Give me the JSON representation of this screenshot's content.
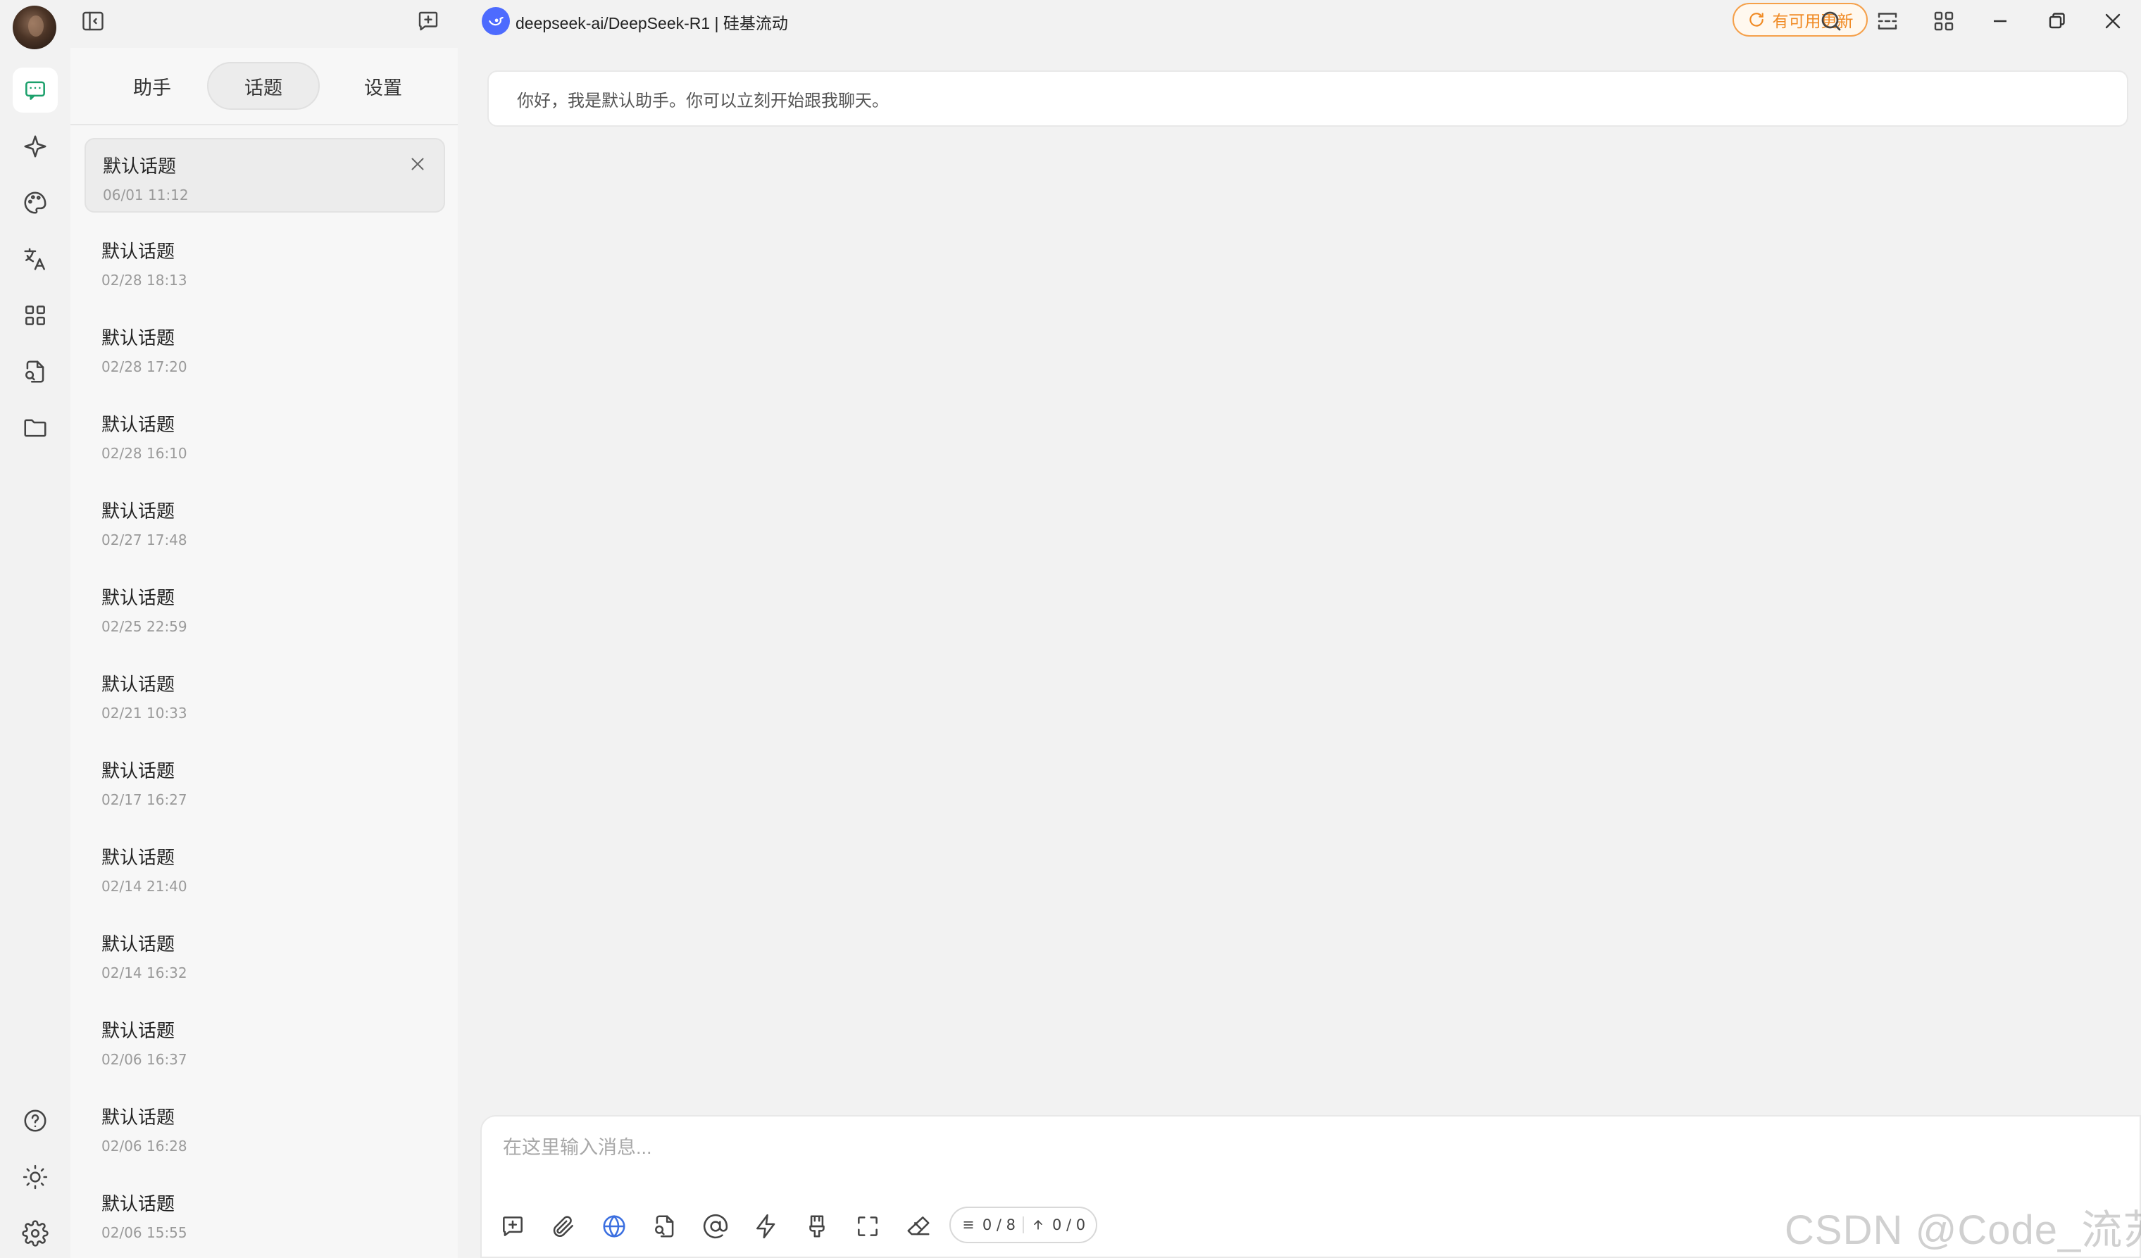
{
  "app": {
    "model_title": "deepseek-ai/DeepSeek-R1 | 硅基流动",
    "update_label": "有可用更新",
    "accent_color": "#1ba06b",
    "update_color": "#f08a24",
    "model_logo_color": "#4d6bfe"
  },
  "rail": {
    "items": [
      {
        "name": "chat-icon",
        "active": true
      },
      {
        "name": "sparkle-icon",
        "active": false
      },
      {
        "name": "palette-icon",
        "active": false
      },
      {
        "name": "translate-icon",
        "active": false
      },
      {
        "name": "apps-grid-icon",
        "active": false
      },
      {
        "name": "file-search-icon",
        "active": false
      },
      {
        "name": "folder-icon",
        "active": false
      }
    ],
    "bottom_items": [
      "help-icon",
      "sun-icon",
      "gear-icon"
    ]
  },
  "tabs": {
    "assistant": "助手",
    "topics": "话题",
    "settings": "设置",
    "active": "topics"
  },
  "topics": [
    {
      "title": "默认话题",
      "time": "06/01 11:12",
      "active": true
    },
    {
      "title": "默认话题",
      "time": "02/28 18:13"
    },
    {
      "title": "默认话题",
      "time": "02/28 17:20"
    },
    {
      "title": "默认话题",
      "time": "02/28 16:10"
    },
    {
      "title": "默认话题",
      "time": "02/27 17:48"
    },
    {
      "title": "默认话题",
      "time": "02/25 22:59"
    },
    {
      "title": "默认话题",
      "time": "02/21 10:33"
    },
    {
      "title": "默认话题",
      "time": "02/17 16:27"
    },
    {
      "title": "默认话题",
      "time": "02/14 21:40"
    },
    {
      "title": "默认话题",
      "time": "02/14 16:32"
    },
    {
      "title": "默认话题",
      "time": "02/06 16:37"
    },
    {
      "title": "默认话题",
      "time": "02/06 16:28"
    },
    {
      "title": "默认话题",
      "time": "02/06 15:55"
    }
  ],
  "chat": {
    "greeting": "你好，我是默认助手。你可以立刻开始跟我聊天。"
  },
  "composer": {
    "placeholder": "在这里输入消息...",
    "context_count": "0 / 8",
    "token_count": "0 / 0"
  },
  "watermark": "CSDN @Code_流苏"
}
